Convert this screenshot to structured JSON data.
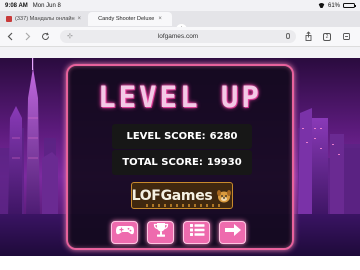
{
  "status_bar": {
    "time": "9:08 AM",
    "date": "Mon Jun 8",
    "battery": "61%",
    "battery_level": 0.61,
    "icons": [
      "wifi-icon",
      "battery-icon"
    ]
  },
  "tabs": [
    {
      "title": "(337) Мандалы онлайн",
      "favicon": "youtube-icon",
      "active": false
    },
    {
      "title": "Candy Shooter Deluxe",
      "active": true
    }
  ],
  "toolbar": {
    "url": "lofgames.com",
    "tab_count": "2",
    "icons": [
      "back-icon",
      "forward-icon",
      "reading-mode-icon",
      "microphone-icon",
      "share-icon",
      "tabs-icon",
      "more-icon"
    ]
  },
  "game": {
    "title": "LEVEL UP",
    "level_score_label": "LEVEL SCORE:",
    "level_score": "6280",
    "total_score_label": "TOTAL SCORE:",
    "total_score": "19930",
    "logo_text": "LOFGames",
    "buttons": [
      "gamepad-icon",
      "trophy-icon",
      "menu-list-icon",
      "next-arrow-icon"
    ],
    "colors": {
      "accent_pink": "#ee6bae",
      "panel_border": "#e8629c",
      "score_box": "#171717"
    }
  }
}
